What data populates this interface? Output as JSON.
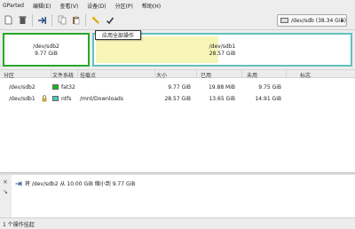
{
  "menubar": {
    "items": [
      "GParted",
      "编辑(E)",
      "查看(V)",
      "设备(D)",
      "分区(P)",
      "帮助(H)"
    ]
  },
  "toolbar": {
    "tooltip": "应用全部操作"
  },
  "device_selector": {
    "value": "/dev/sdb (38.34 GiB)"
  },
  "diskmap": {
    "partitions": [
      {
        "name": "/dev/sdb2",
        "size": "9.77 GiB"
      },
      {
        "name": "/dev/sdb1",
        "size": "28.57 GiB"
      }
    ]
  },
  "table": {
    "headers": [
      "分区",
      "文件系统",
      "挂载点",
      "大小",
      "已用",
      "未用",
      "标志"
    ],
    "rows": [
      {
        "partition": "/dev/sdb2",
        "filesystem": "fat32",
        "mountpoint": "",
        "size": "9.77 GiB",
        "used": "19.88 MiB",
        "unused": "9.75 GiB",
        "flags": "",
        "fs_color": "#18b818"
      },
      {
        "partition": "/dev/sdb1",
        "filesystem": "ntfs",
        "mountpoint": "/mnt/Downloads",
        "size": "28.57 GiB",
        "used": "13.65 GiB",
        "unused": "14.91 GiB",
        "flags": "",
        "fs_color": "#42c8c0",
        "locked": true
      }
    ]
  },
  "operations": {
    "items": [
      "将 /dev/sdb2 从 10.00 GiB 缩小到 9.77 GiB"
    ]
  },
  "statusbar": {
    "text": "1 个操作挂起"
  },
  "colors": {
    "fat32": "#18b818",
    "ntfs": "#42c8c0",
    "used_fill": "#f7f5b8"
  }
}
